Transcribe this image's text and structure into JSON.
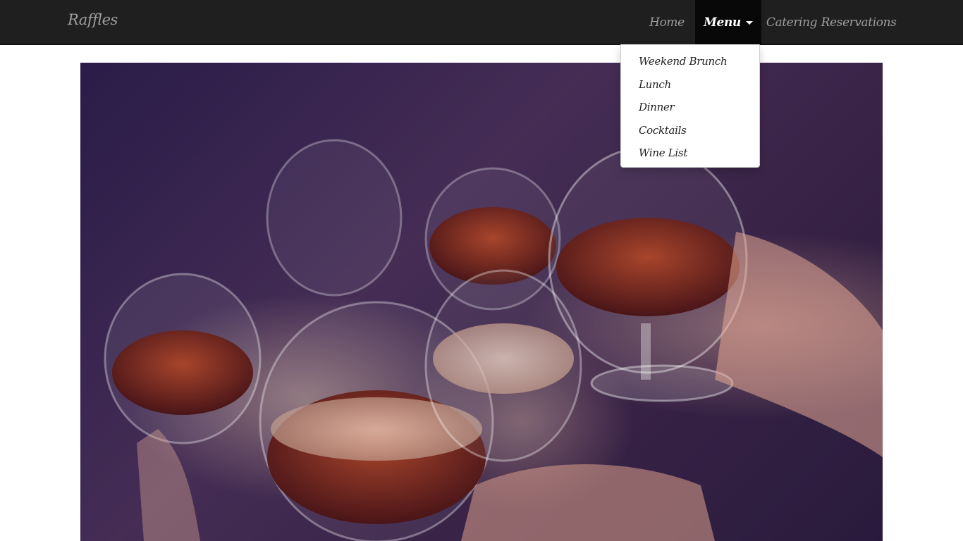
{
  "navbar": {
    "brand": "Raffles",
    "items": [
      {
        "label": "Home"
      },
      {
        "label": "Menu"
      },
      {
        "label": "Catering"
      },
      {
        "label": "Reservations"
      }
    ]
  },
  "dropdown": {
    "items": [
      {
        "label": "Weekend Brunch"
      },
      {
        "label": "Lunch"
      },
      {
        "label": "Dinner"
      },
      {
        "label": "Cocktails"
      },
      {
        "label": "Wine List"
      }
    ]
  },
  "hero": {
    "image_icon": "toasting-glasses-photo",
    "colors": {
      "navbar_bg": "#1f1f1f",
      "active_nav_bg": "#080808",
      "nav_text": "#9d9d9d"
    }
  }
}
